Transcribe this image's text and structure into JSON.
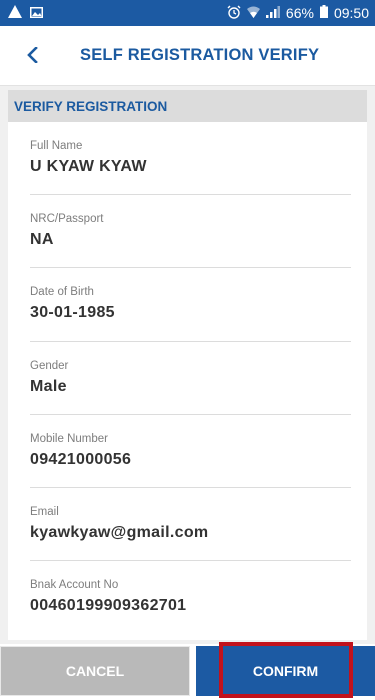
{
  "status_bar": {
    "left_icons": [
      "warning-icon",
      "gallery-icon"
    ],
    "battery": "66%",
    "time": "09:50"
  },
  "header": {
    "title": "SELF REGISTRATION VERIFY"
  },
  "section": {
    "title": "VERIFY REGISTRATION"
  },
  "fields": [
    {
      "label": "Full Name",
      "value": "U KYAW KYAW"
    },
    {
      "label": "NRC/Passport",
      "value": "NA"
    },
    {
      "label": "Date of Birth",
      "value": "30-01-1985"
    },
    {
      "label": "Gender",
      "value": "Male"
    },
    {
      "label": "Mobile Number",
      "value": "09421000056"
    },
    {
      "label": "Email",
      "value": "kyawkyaw@gmail.com"
    },
    {
      "label": "Bnak Account No",
      "value": "00460199909362701"
    }
  ],
  "buttons": {
    "cancel": "CANCEL",
    "confirm": "CONFIRM"
  },
  "colors": {
    "primary": "#1c5aa3",
    "cancel_bg": "#b9b9b9",
    "highlight": "#c1121c"
  }
}
